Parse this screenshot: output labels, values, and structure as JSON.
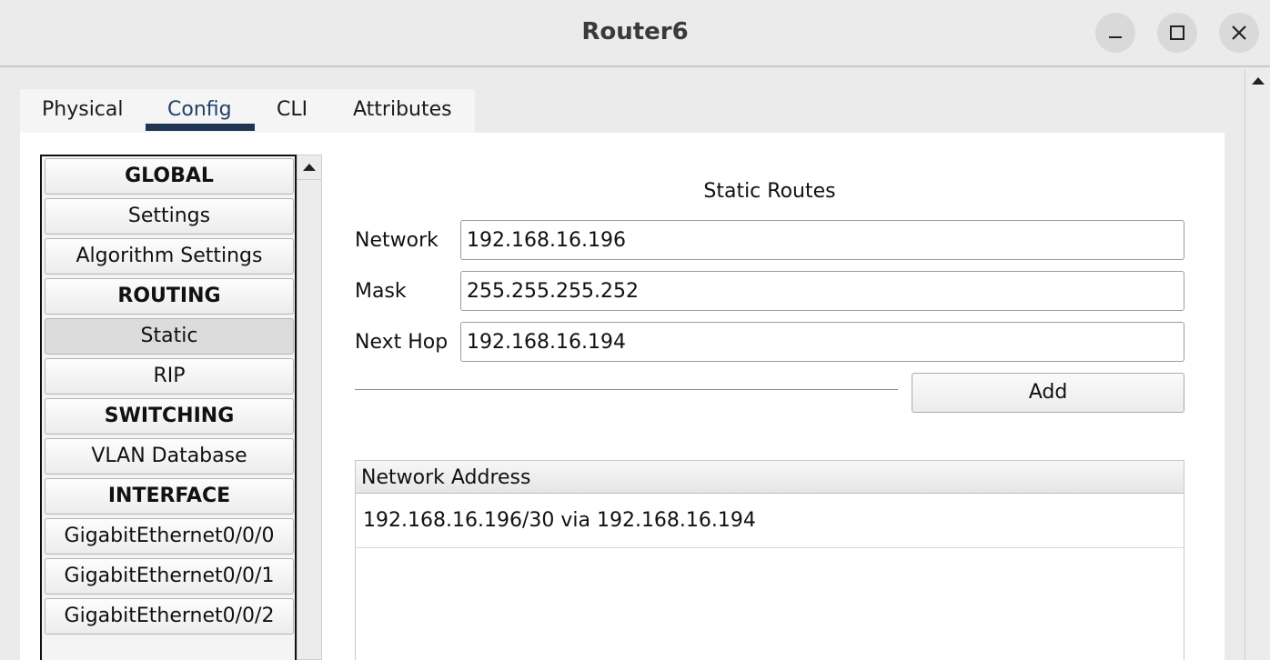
{
  "window": {
    "title": "Router6",
    "controls": [
      "minimize-icon",
      "maximize-icon",
      "close-icon"
    ]
  },
  "tabs": [
    {
      "label": "Physical",
      "active": false
    },
    {
      "label": "Config",
      "active": true
    },
    {
      "label": "CLI",
      "active": false
    },
    {
      "label": "Attributes",
      "active": false
    }
  ],
  "sidebar": {
    "items": [
      {
        "label": "GLOBAL",
        "type": "header"
      },
      {
        "label": "Settings",
        "type": "item"
      },
      {
        "label": "Algorithm Settings",
        "type": "item"
      },
      {
        "label": "ROUTING",
        "type": "header"
      },
      {
        "label": "Static",
        "type": "item",
        "selected": true
      },
      {
        "label": "RIP",
        "type": "item"
      },
      {
        "label": "SWITCHING",
        "type": "header"
      },
      {
        "label": "VLAN Database",
        "type": "item"
      },
      {
        "label": "INTERFACE",
        "type": "header"
      },
      {
        "label": "GigabitEthernet0/0/0",
        "type": "item"
      },
      {
        "label": "GigabitEthernet0/0/1",
        "type": "item"
      },
      {
        "label": "GigabitEthernet0/0/2",
        "type": "item"
      }
    ]
  },
  "static_routes": {
    "title": "Static Routes",
    "fields": {
      "network": {
        "label": "Network",
        "value": "192.168.16.196"
      },
      "mask": {
        "label": "Mask",
        "value": "255.255.255.252"
      },
      "next_hop": {
        "label": "Next Hop",
        "value": "192.168.16.194"
      }
    },
    "add_label": "Add",
    "table": {
      "header": "Network Address",
      "rows": [
        "192.168.16.196/30 via 192.168.16.194"
      ]
    }
  }
}
